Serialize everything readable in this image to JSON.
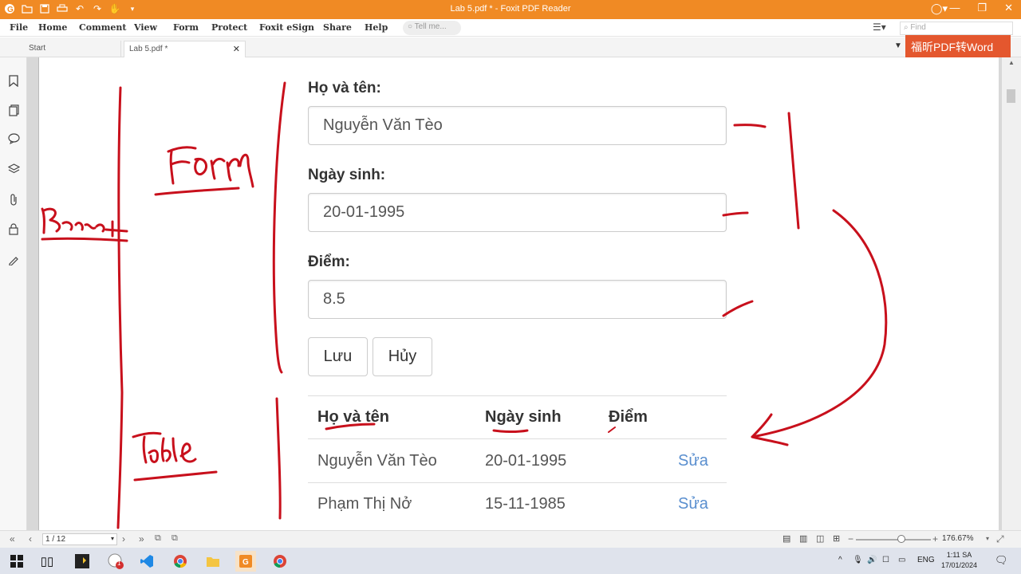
{
  "window": {
    "title": "Lab 5.pdf * - Foxit PDF Reader"
  },
  "menu": {
    "items": [
      "File",
      "Home",
      "Comment",
      "View",
      "Form",
      "Protect",
      "Foxit eSign",
      "Share",
      "Help"
    ],
    "tell_me_placeholder": "Tell me...",
    "find_placeholder": "Find"
  },
  "tabs": [
    {
      "label": "Start"
    },
    {
      "label": "Lab 5.pdf *"
    }
  ],
  "ad_banner": "福昕PDF转Word",
  "document": {
    "form": {
      "name_label": "Họ và tên:",
      "name_value": "Nguyễn Văn Tèo",
      "dob_label": "Ngày sinh:",
      "dob_value": "20-01-1995",
      "score_label": "Điểm:",
      "score_value": "8.5",
      "save_button": "Lưu",
      "cancel_button": "Hủy"
    },
    "table": {
      "headers": [
        "Họ và tên",
        "Ngày sinh",
        "Điểm"
      ],
      "rows": [
        {
          "name": "Nguyễn Văn Tèo",
          "dob": "20-01-1995",
          "action": "Sửa"
        },
        {
          "name": "Phạm Thị Nở",
          "dob": "15-11-1985",
          "action": "Sửa"
        }
      ]
    }
  },
  "status": {
    "page_indicator": "1 / 12",
    "zoom": "176.67%"
  },
  "taskbar": {
    "language": "ENG",
    "time": "1:11 SA",
    "date": "17/01/2024",
    "badge_count": "1"
  },
  "colors": {
    "titlebar": "#f08a24",
    "ad_banner": "#e4572e",
    "annotation_ink": "#c8101c",
    "link": "#5a8fcf"
  }
}
